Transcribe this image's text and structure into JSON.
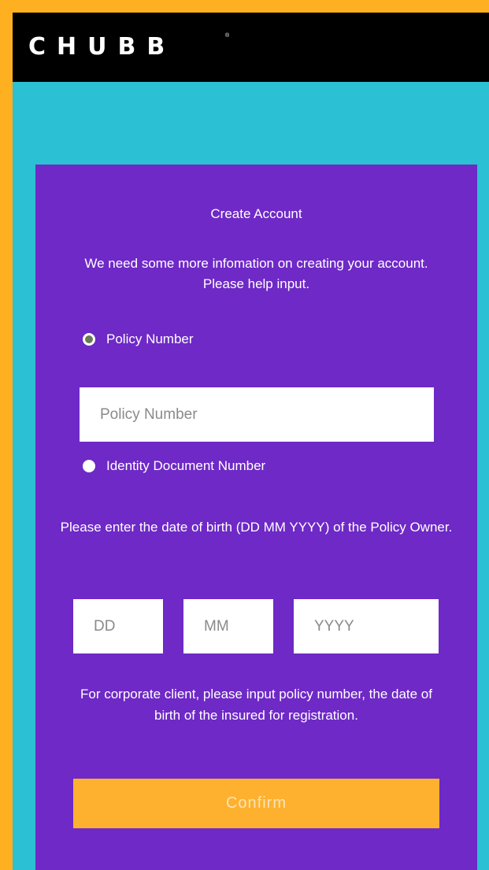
{
  "header": {
    "logo_text": "CHUBB",
    "logo_mark": "®"
  },
  "form": {
    "title": "Create Account",
    "intro": "We need some more infomation on creating your account. Please help input.",
    "options": [
      {
        "label": "Policy Number",
        "selected": true
      },
      {
        "label": "Identity Document Number",
        "selected": false
      }
    ],
    "policy_input": {
      "value": "",
      "placeholder": "Policy Number"
    },
    "dob_note": "Please enter the date of birth (DD MM YYYY) of the Policy Owner.",
    "dob": {
      "day": {
        "value": "",
        "placeholder": "DD"
      },
      "month": {
        "value": "",
        "placeholder": "MM"
      },
      "year": {
        "value": "",
        "placeholder": "YYYY"
      }
    },
    "corporate_note": "For corporate client, please input policy number, the date of birth of the insured for registration.",
    "confirm_label": "Confirm"
  },
  "colors": {
    "outer_border": "#FFB020",
    "background": "#2BC0D4",
    "header": "#000000",
    "card": "#6E29C6",
    "button": "#FEB12F",
    "button_text": "#FCE3B4",
    "radio_dot": "#6B7A55"
  },
  "icons": {
    "radio_selected": "radio-checked-icon",
    "radio_unselected": "radio-unchecked-icon"
  }
}
